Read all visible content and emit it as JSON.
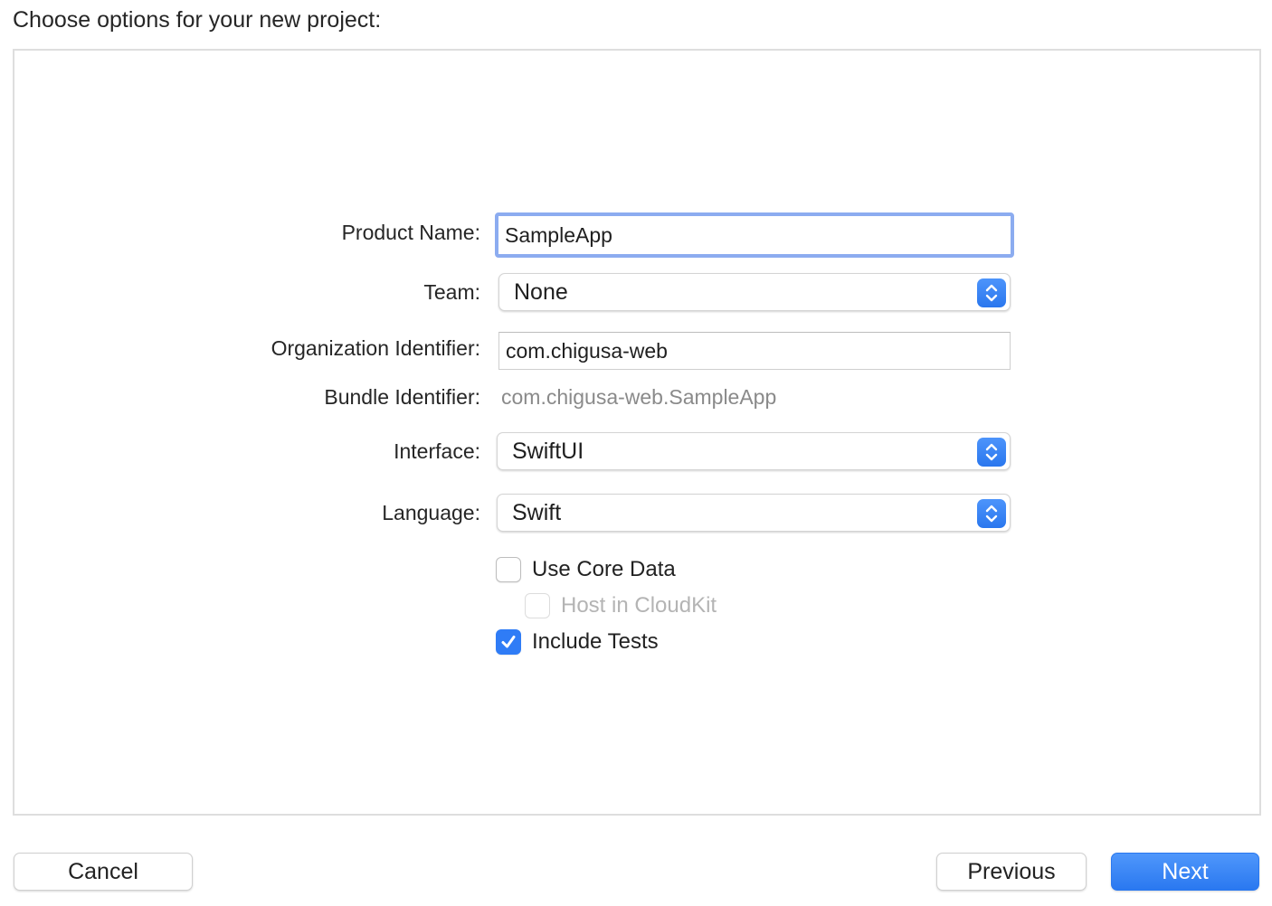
{
  "heading": "Choose options for your new project:",
  "form": {
    "product_name": {
      "label": "Product Name:",
      "value": "SampleApp"
    },
    "team": {
      "label": "Team:",
      "value": "None"
    },
    "organization_identifier": {
      "label": "Organization Identifier:",
      "value": "com.chigusa-web"
    },
    "bundle_identifier": {
      "label": "Bundle Identifier:",
      "value": "com.chigusa-web.SampleApp"
    },
    "interface": {
      "label": "Interface:",
      "value": "SwiftUI"
    },
    "language": {
      "label": "Language:",
      "value": "Swift"
    },
    "use_core_data": {
      "label": "Use Core Data",
      "checked": false
    },
    "host_in_cloudkit": {
      "label": "Host in CloudKit",
      "checked": false,
      "enabled": false
    },
    "include_tests": {
      "label": "Include Tests",
      "checked": true
    }
  },
  "buttons": {
    "cancel": "Cancel",
    "previous": "Previous",
    "next": "Next"
  },
  "colors": {
    "accent": "#2f7cf6",
    "focus_ring": "#8cacf0"
  },
  "icons": {
    "popup_arrows": "chevron-up-down-icon",
    "check": "checkmark-icon"
  }
}
